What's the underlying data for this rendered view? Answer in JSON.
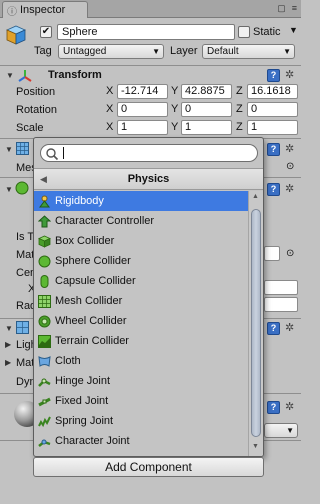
{
  "window": {
    "tab_title": "Inspector"
  },
  "object": {
    "active": true,
    "name": "Sphere",
    "static_label": "Static",
    "tag_label": "Tag",
    "tag_value": "Untagged",
    "layer_label": "Layer",
    "layer_value": "Default"
  },
  "transform": {
    "title": "Transform",
    "position": {
      "label": "Position",
      "x": "-12.714",
      "y": "42.8875",
      "z": "16.1618"
    },
    "rotation": {
      "label": "Rotation",
      "x": "0",
      "y": "0",
      "z": "0"
    },
    "scale": {
      "label": "Scale",
      "x": "1",
      "y": "1",
      "z": "1"
    }
  },
  "axis": {
    "x": "X",
    "y": "Y",
    "z": "Z"
  },
  "hidden_left": {
    "mesh": "Mes",
    "is_trigger": "Is T",
    "material": "Mat",
    "center": "Cen",
    "x": "X",
    "radius": "Rad",
    "lighting": "Ligh",
    "materials": "Mat",
    "dynamic": "Dyn"
  },
  "popup": {
    "search_placeholder": "",
    "title": "Physics",
    "items": [
      {
        "label": "Rigidbody",
        "icon": "rigidbody-icon",
        "selected": true
      },
      {
        "label": "Character Controller",
        "icon": "character-controller-icon"
      },
      {
        "label": "Box Collider",
        "icon": "box-collider-icon"
      },
      {
        "label": "Sphere Collider",
        "icon": "sphere-collider-icon"
      },
      {
        "label": "Capsule Collider",
        "icon": "capsule-collider-icon"
      },
      {
        "label": "Mesh Collider",
        "icon": "mesh-collider-icon"
      },
      {
        "label": "Wheel Collider",
        "icon": "wheel-collider-icon"
      },
      {
        "label": "Terrain Collider",
        "icon": "terrain-collider-icon"
      },
      {
        "label": "Cloth",
        "icon": "cloth-icon"
      },
      {
        "label": "Hinge Joint",
        "icon": "hinge-joint-icon"
      },
      {
        "label": "Fixed Joint",
        "icon": "fixed-joint-icon"
      },
      {
        "label": "Spring Joint",
        "icon": "spring-joint-icon"
      },
      {
        "label": "Character Joint",
        "icon": "character-joint-icon"
      }
    ]
  },
  "add_component_label": "Add Component",
  "colors": {
    "selection": "#3e7ae1",
    "panel": "#c2c2c2"
  }
}
